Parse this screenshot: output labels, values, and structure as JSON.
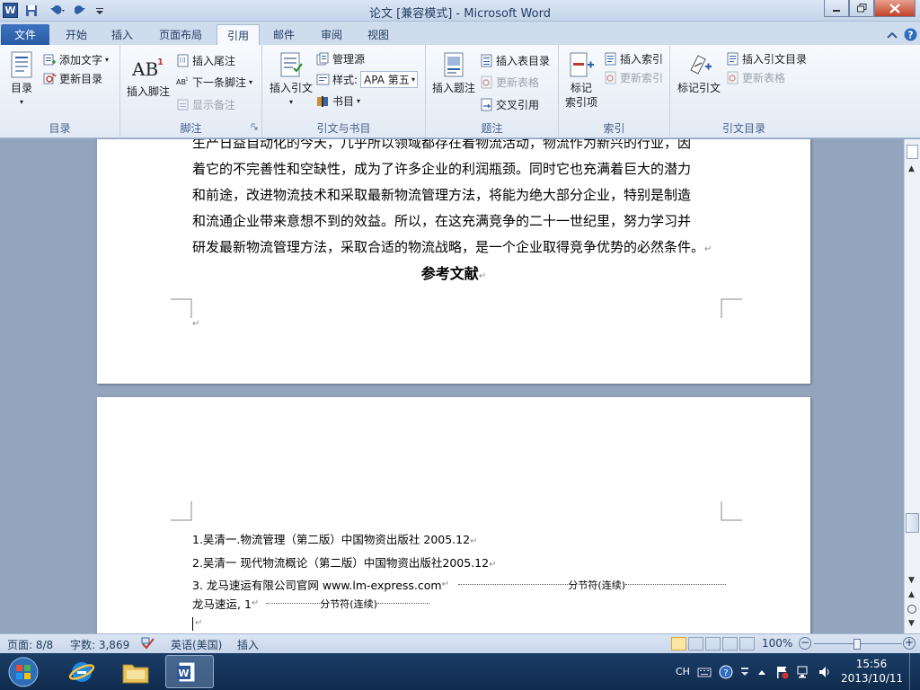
{
  "window": {
    "title": "论文 [兼容模式] - Microsoft Word",
    "logo_letter": "W"
  },
  "tabs": [
    {
      "label": "文件"
    },
    {
      "label": "开始"
    },
    {
      "label": "插入"
    },
    {
      "label": "页面布局"
    },
    {
      "label": "引用",
      "active": true
    },
    {
      "label": "邮件"
    },
    {
      "label": "审阅"
    },
    {
      "label": "视图"
    }
  ],
  "ribbon": {
    "toc": {
      "group_label": "目录",
      "toc_button": "目录",
      "add_text": "添加文字",
      "update_toc": "更新目录"
    },
    "footnotes": {
      "group_label": "脚注",
      "insert_footnote": "插入脚注",
      "insert_endnote": "插入尾注",
      "next_footnote": "下一条脚注",
      "show_notes": "显示备注",
      "icon_text": "AB",
      "icon_sup": "1"
    },
    "citations": {
      "group_label": "引文与书目",
      "insert_citation": "插入引文",
      "manage_sources": "管理源",
      "style_label": "样式:",
      "style_value": "APA 第五",
      "bibliography": "书目"
    },
    "captions": {
      "group_label": "题注",
      "insert_caption": "插入题注",
      "insert_table_of_figures": "插入表目录",
      "update_table": "更新表格",
      "cross_reference": "交叉引用"
    },
    "index": {
      "group_label": "索引",
      "mark_entry": "标记\n索引项",
      "insert_index": "插入索引",
      "update_index": "更新索引"
    },
    "toa": {
      "group_label": "引文目录",
      "mark_citation": "标记引文",
      "insert_toa": "插入引文目录",
      "update_table": "更新表格"
    }
  },
  "document": {
    "paragraph_lines": [
      "生产日益自动化的今天，几乎所以领域都存在着物流活动，物流作为新兴的行业，因",
      "着它的不完善性和空缺性，成为了许多企业的利润瓶颈。同时它也充满着巨大的潜力",
      "和前途，改进物流技术和采取最新物流管理方法，将能为绝大部分企业，特别是制造",
      "和流通企业带来意想不到的效益。所以，在这充满竞争的二十一世纪里，努力学习并",
      "研发最新物流管理方法，采取合适的物流战略，是一个企业取得竞争优势的必然条件。"
    ],
    "heading": "参考文献",
    "references": [
      "1.吴清一.物流管理（第二版）中国物资出版社 2005.12",
      "2.吴清一 现代物流概论（第二版）中国物资出版社2005.12",
      "3. 龙马速运有限公司官网 www.lm-express.com"
    ],
    "section_break": "分节符(连续)",
    "footer_line": "龙马速运, 1",
    "para_mark": "↵"
  },
  "status": {
    "page": "页面: 8/8",
    "words": "字数: 3,869",
    "language": "英语(美国)",
    "mode": "插入",
    "zoom": "100%",
    "zoom_level_percent": 100
  },
  "taskbar": {
    "ime": "CH",
    "time": "15:56",
    "date": "2013/10/11"
  }
}
